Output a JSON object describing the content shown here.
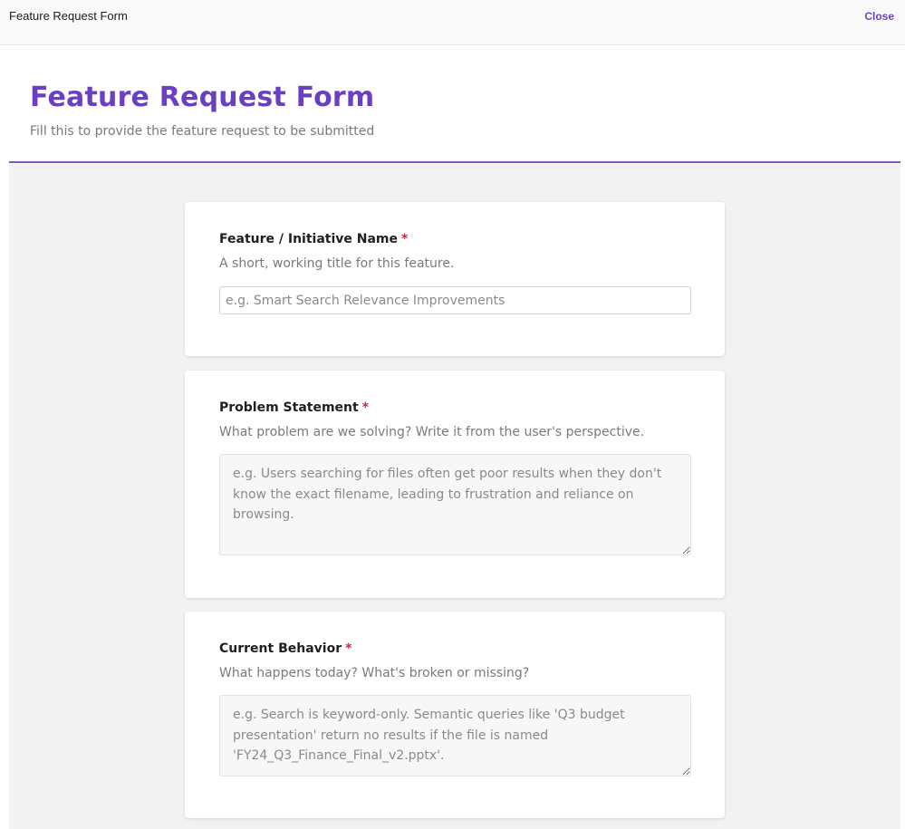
{
  "topbar": {
    "title": "Feature Request Form",
    "close_label": "Close"
  },
  "header": {
    "title": "Feature Request Form",
    "subtitle": "Fill this to provide the feature request to be submitted"
  },
  "colors": {
    "accent": "#6b3fc4",
    "required": "#d4213d"
  },
  "fields": [
    {
      "label": "Feature / Initiative Name",
      "required_marker": "*",
      "help": "A short, working title for this feature.",
      "type": "text",
      "value": "",
      "placeholder": "e.g. Smart Search Relevance Improvements"
    },
    {
      "label": "Problem Statement",
      "required_marker": "*",
      "help": "What problem are we solving? Write it from the user's perspective.",
      "type": "textarea",
      "value": "",
      "placeholder": "e.g. Users searching for files often get poor results when they don't know the exact filename, leading to frustration and reliance on browsing."
    },
    {
      "label": "Current Behavior",
      "required_marker": "*",
      "help": "What happens today? What's broken or missing?",
      "type": "textarea",
      "value": "",
      "placeholder": "e.g. Search is keyword-only. Semantic queries like 'Q3 budget presentation' return no results if the file is named 'FY24_Q3_Finance_Final_v2.pptx'."
    }
  ]
}
